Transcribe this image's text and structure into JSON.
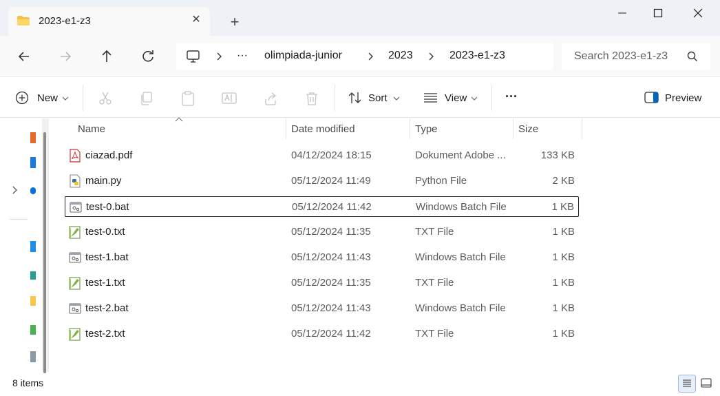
{
  "window": {
    "tab_title": "2023-e1-z3",
    "new_tab_label": "+"
  },
  "breadcrumb": {
    "overflow": "···",
    "items": [
      "olimpiada-junior",
      "2023",
      "2023-e1-z3"
    ]
  },
  "search": {
    "placeholder": "Search 2023-e1-z3"
  },
  "toolbar": {
    "new_label": "New",
    "sort_label": "Sort",
    "view_label": "View",
    "more_label": "···",
    "preview_label": "Preview"
  },
  "columns": {
    "name": "Name",
    "date": "Date modified",
    "type": "Type",
    "size": "Size"
  },
  "files": [
    {
      "name": "ciazad.pdf",
      "date": "04/12/2024 18:15",
      "type": "Dokument Adobe ...",
      "size": "133 KB",
      "icon": "pdf-icon"
    },
    {
      "name": "main.py",
      "date": "05/12/2024 11:49",
      "type": "Python File",
      "size": "2 KB",
      "icon": "python-file-icon"
    },
    {
      "name": "test-0.bat",
      "date": "05/12/2024 11:42",
      "type": "Windows Batch File",
      "size": "1 KB",
      "icon": "batch-file-icon",
      "selected": true
    },
    {
      "name": "test-0.txt",
      "date": "05/12/2024 11:35",
      "type": "TXT File",
      "size": "1 KB",
      "icon": "notepad-plus-file-icon"
    },
    {
      "name": "test-1.bat",
      "date": "05/12/2024 11:43",
      "type": "Windows Batch File",
      "size": "1 KB",
      "icon": "batch-file-icon"
    },
    {
      "name": "test-1.txt",
      "date": "05/12/2024 11:35",
      "type": "TXT File",
      "size": "1 KB",
      "icon": "notepad-plus-file-icon"
    },
    {
      "name": "test-2.bat",
      "date": "05/12/2024 11:43",
      "type": "Windows Batch File",
      "size": "1 KB",
      "icon": "batch-file-icon"
    },
    {
      "name": "test-2.txt",
      "date": "05/12/2024 11:42",
      "type": "TXT File",
      "size": "1 KB",
      "icon": "notepad-plus-file-icon"
    }
  ],
  "status": {
    "item_count": "8 items"
  },
  "colors": {
    "titlebar": "#eef1f6",
    "selection_border": "#1b1b1b",
    "accent": "#0067c0"
  }
}
